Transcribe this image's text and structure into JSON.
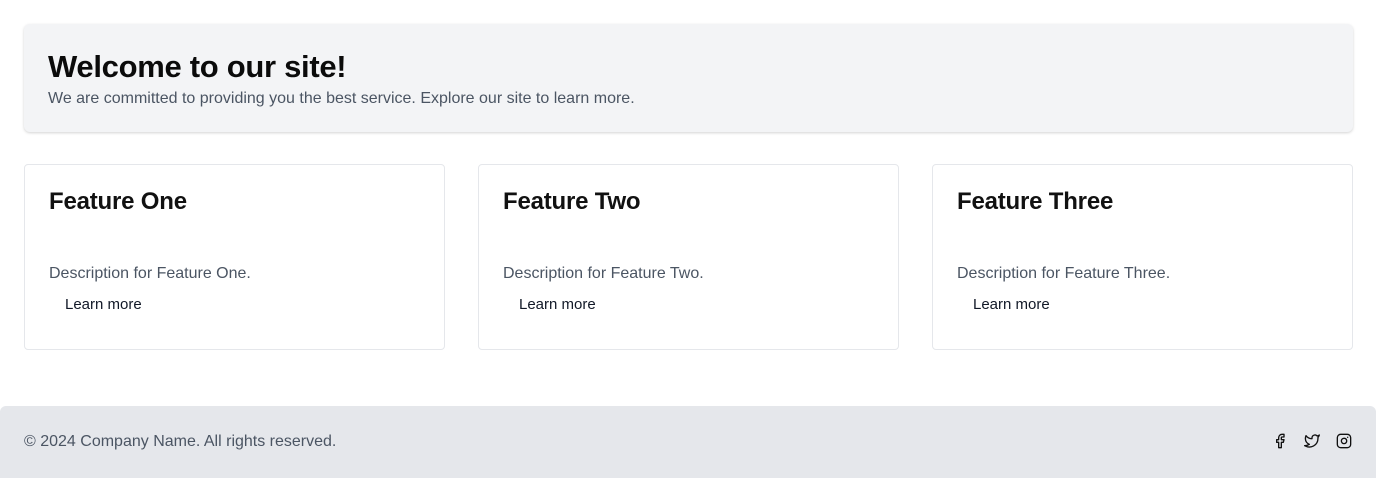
{
  "hero": {
    "title": "Welcome to our site!",
    "subtitle": "We are committed to providing you the best service. Explore our site to learn more."
  },
  "features": [
    {
      "title": "Feature One",
      "description": "Description for Feature One.",
      "link": "Learn more"
    },
    {
      "title": "Feature Two",
      "description": "Description for Feature Two.",
      "link": "Learn more"
    },
    {
      "title": "Feature Three",
      "description": "Description for Feature Three.",
      "link": "Learn more"
    }
  ],
  "footer": {
    "copyright": "© 2024 Company Name. All rights reserved.",
    "socials": [
      "facebook-icon",
      "twitter-icon",
      "instagram-icon"
    ]
  },
  "colors": {
    "hero_bg": "#f3f4f6",
    "footer_bg": "#e5e7eb",
    "muted_text": "#4b5563",
    "card_border": "#e5e7eb"
  }
}
